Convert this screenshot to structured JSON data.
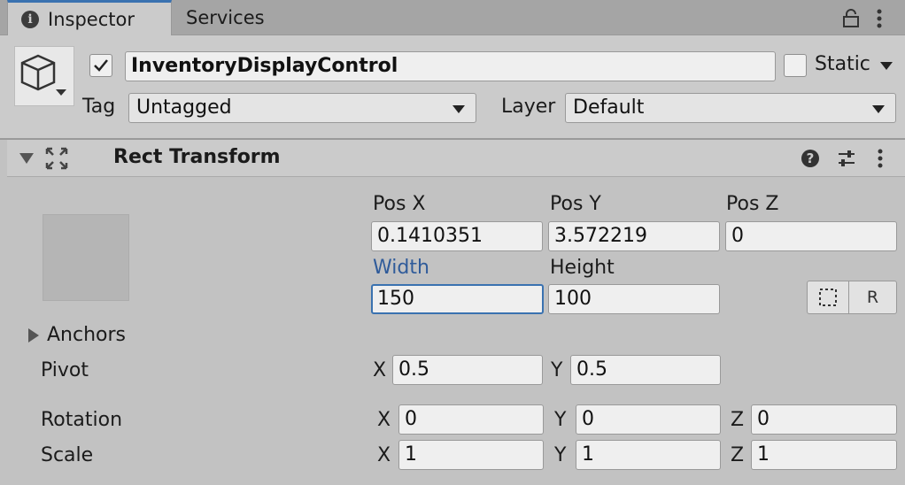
{
  "tabs": [
    {
      "label": "Inspector",
      "active": true
    },
    {
      "label": "Services",
      "active": false
    }
  ],
  "header": {
    "active_checked": true,
    "object_name": "InventoryDisplayControl",
    "static_checked": false,
    "static_label": "Static",
    "tag_label": "Tag",
    "tag_value": "Untagged",
    "layer_label": "Layer",
    "layer_value": "Default"
  },
  "component": {
    "title": "Rect Transform",
    "pos_x_label": "Pos X",
    "pos_y_label": "Pos Y",
    "pos_z_label": "Pos Z",
    "pos_x": "0.1410351",
    "pos_y": "3.572219",
    "pos_z": "0",
    "width_label": "Width",
    "height_label": "Height",
    "width": "150",
    "height": "100",
    "raw_edit_label": "R",
    "anchors_label": "Anchors",
    "pivot_label": "Pivot",
    "pivot_x_label": "X",
    "pivot_y_label": "Y",
    "pivot_x": "0.5",
    "pivot_y": "0.5",
    "rotation_label": "Rotation",
    "rotation_x": "0",
    "rotation_y": "0",
    "rotation_z": "0",
    "scale_label": "Scale",
    "scale_x": "1",
    "scale_y": "1",
    "scale_z": "1",
    "axis_x": "X",
    "axis_y": "Y",
    "axis_z": "Z"
  },
  "colors": {
    "accent": "#3a72b0",
    "panel": "#c2c2c2",
    "tabbar": "#a5a5a5"
  },
  "icons": {
    "info": "info-icon",
    "lock": "lock-icon",
    "menu": "kebab-menu-icon",
    "gameobject": "cube-icon",
    "foldout": "triangle-down-icon",
    "transform": "rect-transform-icon",
    "help": "help-icon",
    "presets": "sliders-icon",
    "blueprint": "blueprint-mode-icon",
    "foldout_closed": "triangle-right-icon"
  }
}
